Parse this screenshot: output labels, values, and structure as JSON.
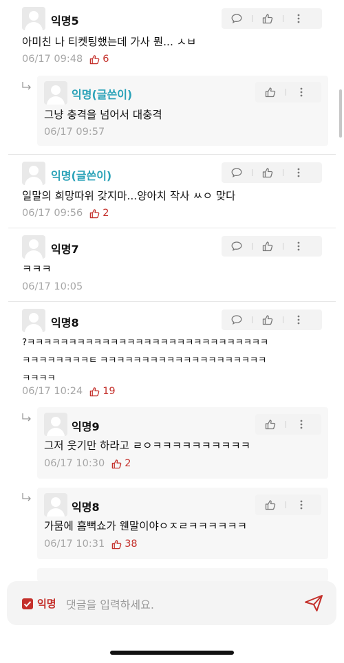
{
  "comments": [
    {
      "name": "익명5",
      "text": "아미친 나 티켓팅했는데 가사 뭔... ㅅㅂ",
      "date": "06/17 09:48",
      "likes": "6"
    },
    {
      "name": "익명(글쓴이)",
      "text": "그냥 충격을 넘어서 대충격",
      "date": "06/17 09:57",
      "likes": ""
    },
    {
      "name": "익명(글쓴이)",
      "text": "일말의 희망따위 갖지마...양아치 작사 ㅆㅇ 맞다",
      "date": "06/17 09:56",
      "likes": "2"
    },
    {
      "name": "익명7",
      "text": "ㅋㅋㅋ",
      "date": "06/17 10:05",
      "likes": ""
    },
    {
      "name": "익명8",
      "text": "?ㅋㅋㅋㅋㅋㅋㅋㅋㅋㅋㅋㅋㅋㅋㅋㅋㅋㅋㅋㅋㅋㅋㅋㅋㅋㅋㅋㅋㅋ\nㅋㅋㅋㅋㅋㅋㅋㅋㅌ ㅋㅋㅋㅋㅋㅋㅋㅋㅋㅋㅋㅋㅋㅋㅋㅋㅋㅋㅋㅋ\nㅋㅋㅋㅋ",
      "date": "06/17 10:24",
      "likes": "19"
    },
    {
      "name": "익명9",
      "text": "그저 웃기만 하라고 ㄹㅇㅋㅋㅋㅋㅋㅋㅋㅋㅋㅋ",
      "date": "06/17 10:30",
      "likes": "2"
    },
    {
      "name": "익명8",
      "text": "가뭄에 흠뻑쇼가 웬말이야ㅇㅈㄹㅋㅋㅋㅋㅋㅋ",
      "date": "06/17 10:31",
      "likes": "38"
    }
  ],
  "composer": {
    "anon_label": "익명",
    "placeholder": "댓글을 입력하세요."
  },
  "colors": {
    "accent": "#c4302b",
    "writer": "#2aa2b8",
    "meta": "#a6a6a6"
  },
  "icons": [
    "comment-icon",
    "thumbs-up-icon",
    "more-icon",
    "reply-arrow-icon",
    "send-icon",
    "checkbox-checked-icon"
  ]
}
